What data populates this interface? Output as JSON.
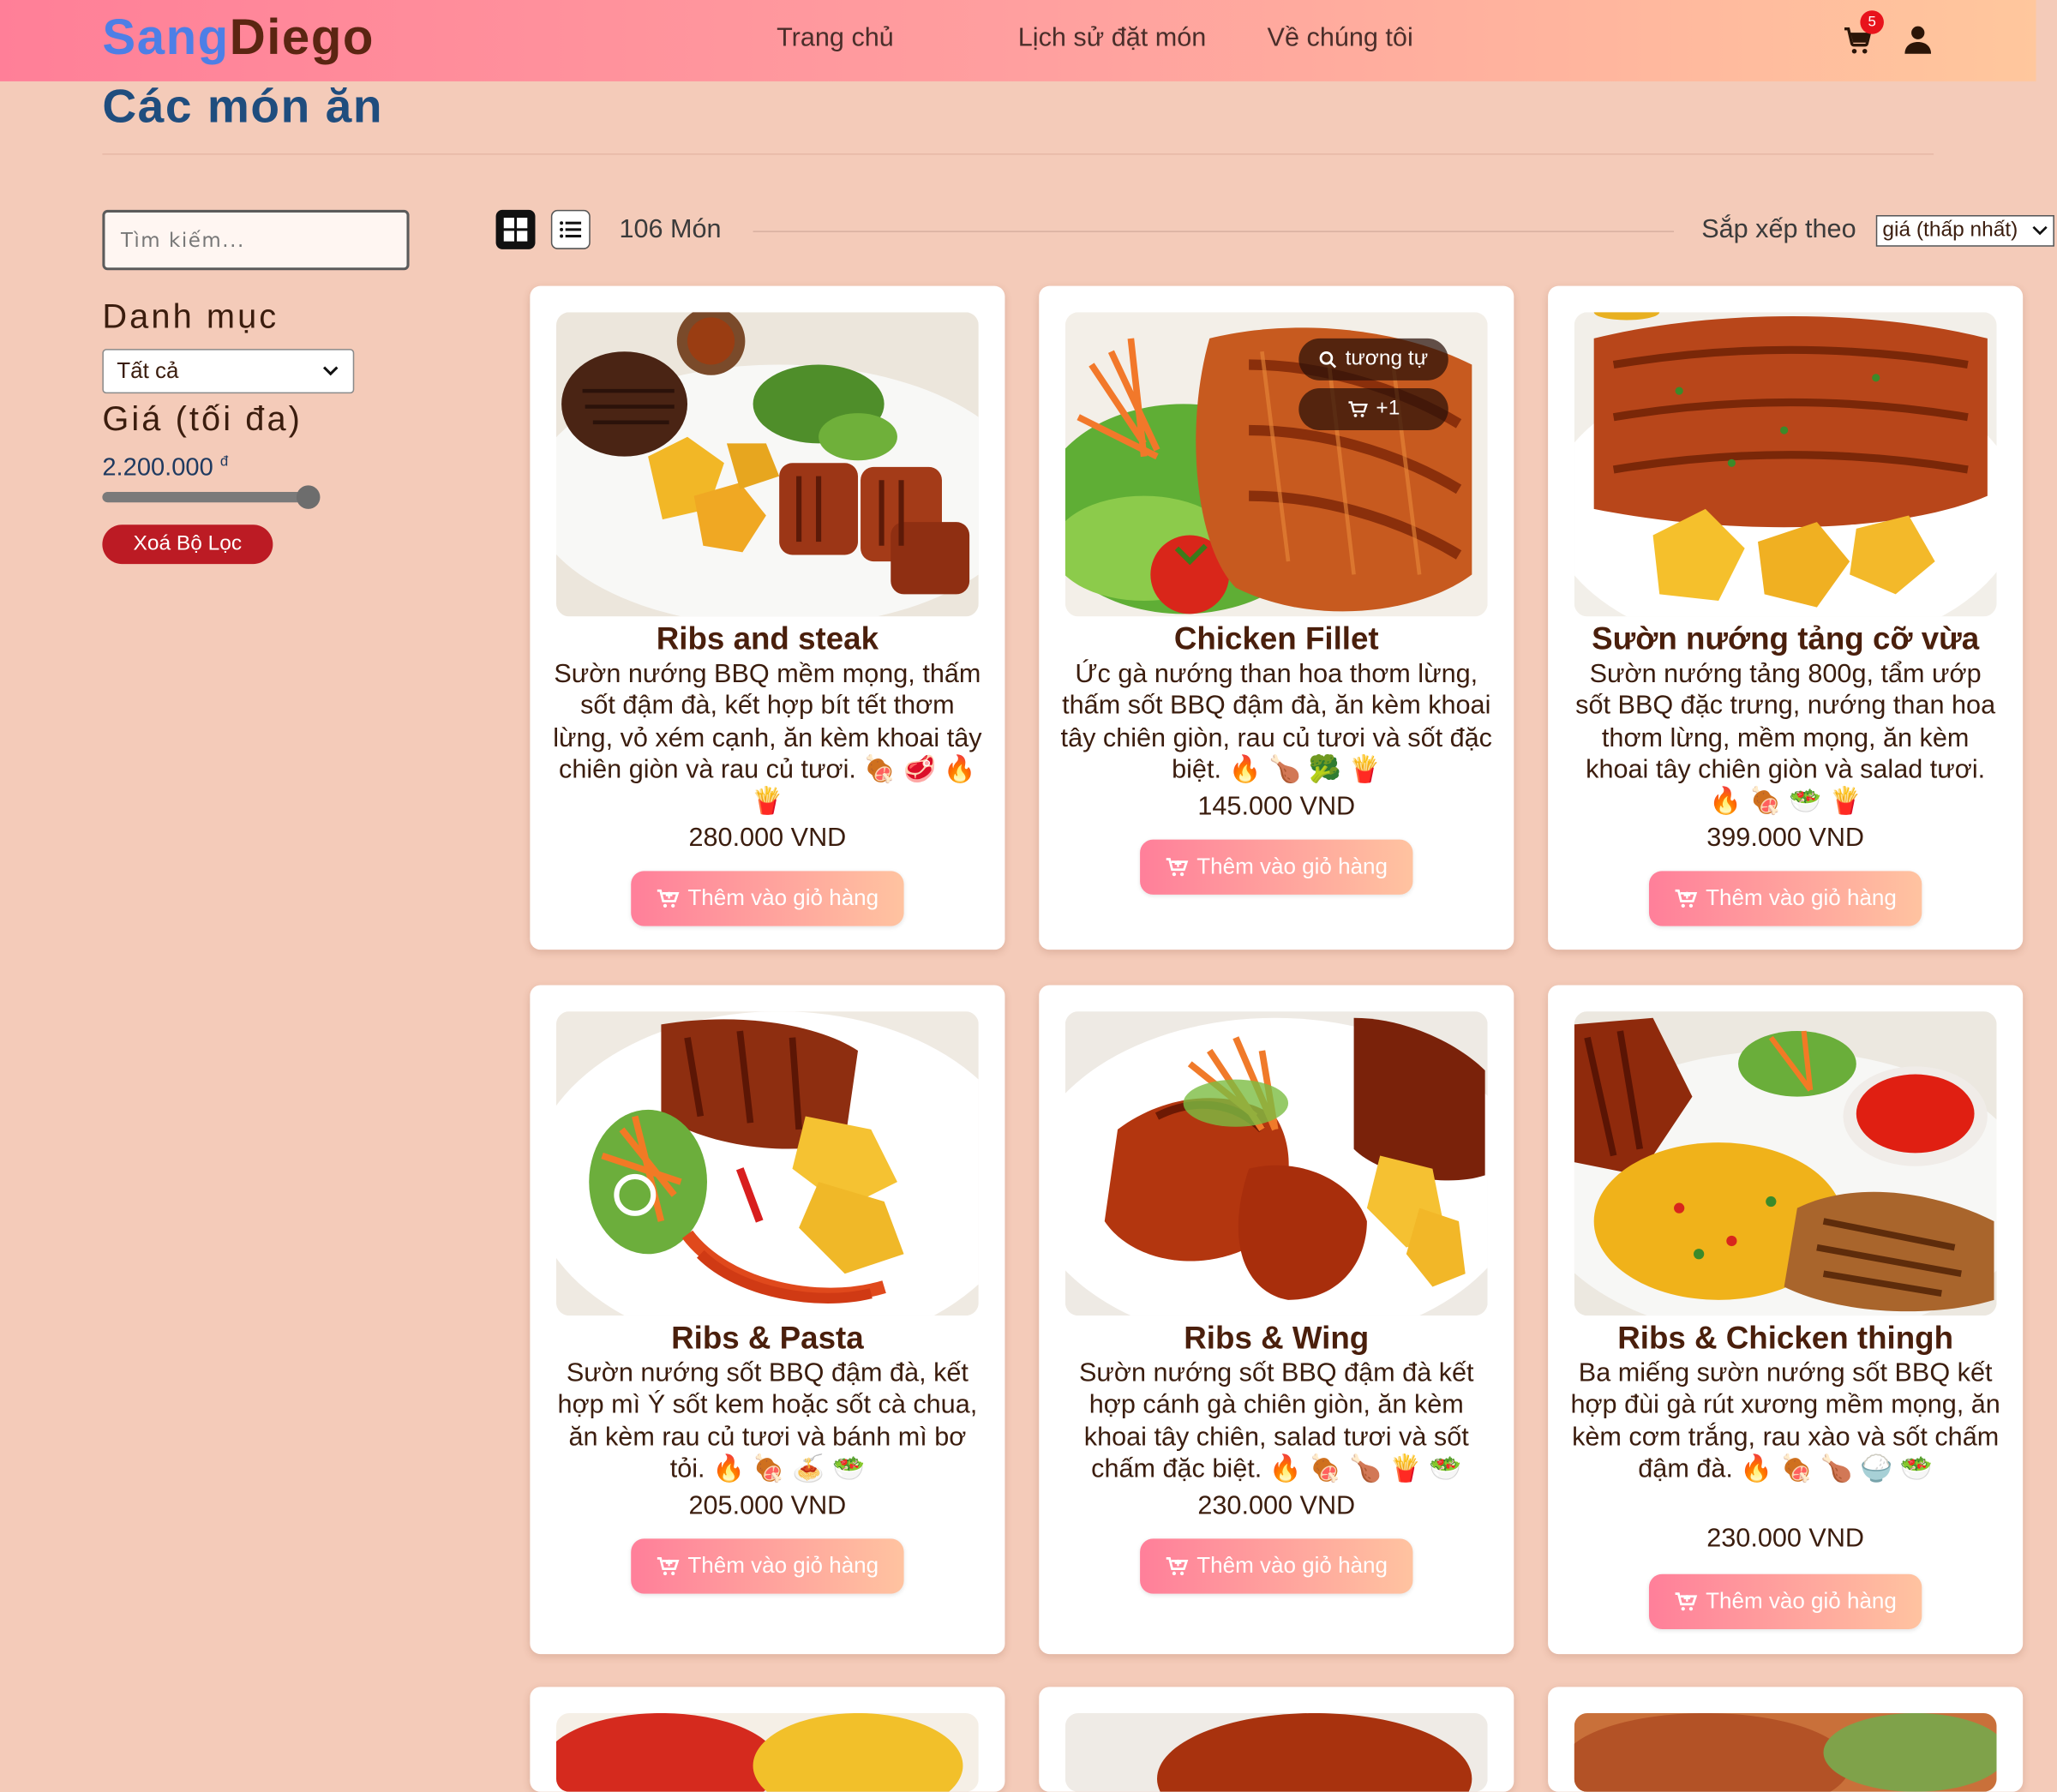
{
  "brand": {
    "part1": "Sang",
    "part2": "Diego"
  },
  "nav": {
    "home": "Trang chủ",
    "history": "Lịch sử đặt món",
    "about": "Về chúng tôi"
  },
  "cart": {
    "count": "5"
  },
  "page_title": "Các món ăn",
  "sidebar": {
    "search_placeholder": "Tìm kiếm...",
    "category_heading": "Danh mục",
    "category_value": "Tất cả",
    "price_heading": "Giá (tối đa)",
    "price_value": "2.200.000",
    "price_currency": "đ",
    "price_slider_fraction": 1,
    "clear_label": "Xoá Bộ Lọc"
  },
  "toolbar": {
    "count_label": "106 Món",
    "sort_label": "Sắp xếp theo",
    "sort_value": "giá (thấp nhất)"
  },
  "add_label": "Thêm vào giỏ hàng",
  "hover_actions": {
    "similar": "tương tự",
    "add_one": "+1"
  },
  "dishes": [
    {
      "name": "Ribs and steak",
      "desc": "Sườn nướng BBQ mềm mọng, thấm sốt đậm đà, kết hợp bít tết thơm lừng, vỏ xém cạnh, ăn kèm khoai tây chiên giòn và rau củ tươi.",
      "emoji": "🍖 🥩 🔥 🍟",
      "price": "280.000 VND"
    },
    {
      "name": "Chicken Fillet",
      "desc": "Ức gà nướng than hoa thơm lừng, thấm sốt BBQ đậm đà, ăn kèm khoai tây chiên giòn, rau củ tươi và sốt đặc biệt.",
      "emoji": "🔥 🍗 🥦 🍟",
      "price": "145.000 VND"
    },
    {
      "name": "Sườn nướng tảng cỡ vừa",
      "desc": "Sườn nướng tảng 800g, tẩm ướp sốt BBQ đặc trưng, nướng than hoa thơm lừng, mềm mọng, ăn kèm khoai tây chiên giòn và salad tươi.",
      "emoji": "🔥 🍖 🥗 🍟",
      "price": "399.000 VND"
    },
    {
      "name": "Ribs & Pasta",
      "desc": "Sườn nướng sốt BBQ đậm đà, kết hợp mì Ý sốt kem hoặc sốt cà chua, ăn kèm rau củ tươi và bánh mì bơ tỏi.",
      "emoji": "🔥 🍖 🍝 🥗",
      "price": "205.000 VND"
    },
    {
      "name": "Ribs & Wing",
      "desc": "Sườn nướng sốt BBQ đậm đà kết hợp cánh gà chiên giòn, ăn kèm khoai tây chiên, salad tươi và sốt chấm đặc biệt.",
      "emoji": "🔥 🍖 🍗 🍟 🥗",
      "price": "230.000 VND"
    },
    {
      "name": "Ribs & Chicken thingh",
      "desc": "Ba miếng sườn nướng sốt BBQ kết hợp đùi gà rút xương mềm mọng, ăn kèm cơm trắng, rau xào và sốt chấm đậm đà.",
      "emoji": "🔥 🍖 🍗 🍚 🥗",
      "price": "230.000 VND"
    }
  ],
  "colors": {
    "accent_gradient_start": "#ff7f9a",
    "accent_gradient_end": "#ffc3a0",
    "title_blue": "#1f4d7e",
    "brand_blue": "#4d7fe6",
    "brand_brown": "#5b2512",
    "danger": "#bc1b24",
    "background": "#f4cbb9"
  },
  "icons": [
    "cart-icon",
    "user-icon",
    "grid-view-icon",
    "list-view-icon",
    "search-icon",
    "cart-plus-icon",
    "chevron-down-icon"
  ]
}
